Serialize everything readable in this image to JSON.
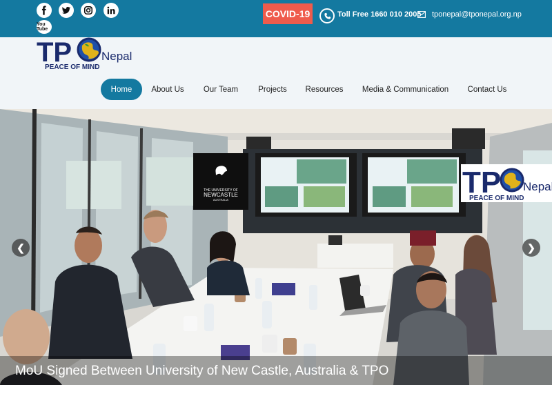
{
  "topbar": {
    "covid_label": "COVID-19",
    "toll_free": "Toll Free 1660 010 2005",
    "email": "tponepal@tponepal.org.np",
    "social_icons": [
      "facebook-icon",
      "twitter-icon",
      "instagram-icon",
      "linkedin-icon",
      "youtube-icon"
    ],
    "youtube_label": "You Tube"
  },
  "logo": {
    "tpo": "TP",
    "nepal": "Nepal",
    "tagline": "PEACE OF MIND"
  },
  "nav": {
    "items": [
      "Home",
      "About Us",
      "Our Team",
      "Projects",
      "Resources",
      "Media & Communication",
      "Contact Us"
    ],
    "active": "Home"
  },
  "hero": {
    "caption": "MoU Signed Between University of New Castle, Australia & TPO",
    "university_sign": [
      "THE UNIVERSITY OF",
      "NEWCASTLE",
      "AUSTRALIA"
    ],
    "photo_logo": {
      "tpo": "TP",
      "nepal": "Nepal",
      "tagline": "PEACE OF MIND"
    }
  },
  "colors": {
    "brand_blue": "#1479a0",
    "covid_red": "#ef5b4c",
    "header_bg": "#f1f5f8"
  }
}
